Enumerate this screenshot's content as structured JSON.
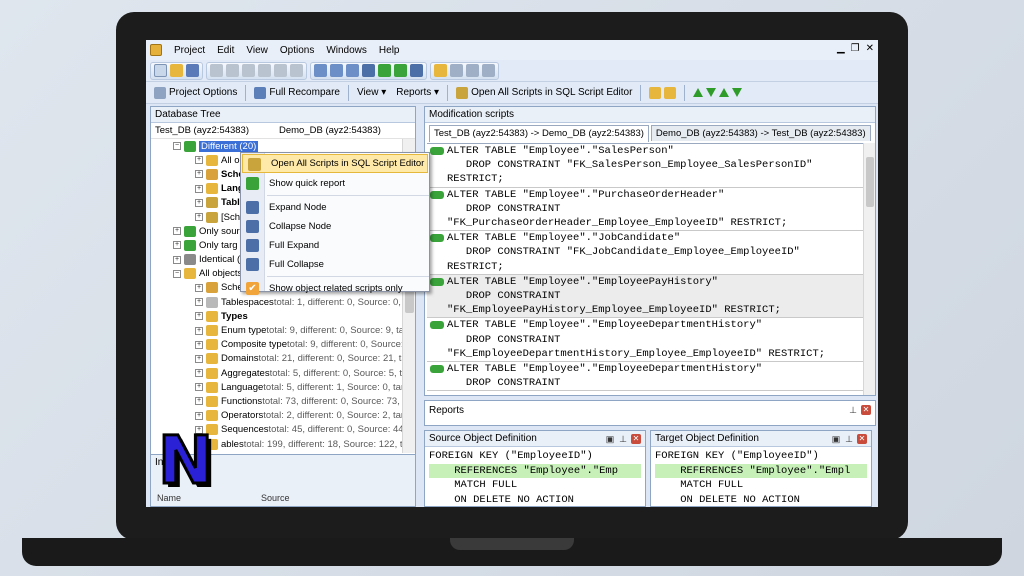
{
  "menu": [
    "Project",
    "Edit",
    "View",
    "Options",
    "Windows",
    "Help"
  ],
  "toolbar2": {
    "project_options": "Project Options",
    "full_recompare": "Full Recompare",
    "view": "View ▾",
    "reports": "Reports ▾",
    "open_all_scripts": "Open All Scripts in SQL Script Editor"
  },
  "database_tree": {
    "title": "Database Tree",
    "left_db": "Test_DB (ayz2:54383)",
    "right_db": "Demo_DB (ayz2:54383)",
    "rows": [
      {
        "label": "Different (20)",
        "detail": ""
      },
      {
        "label": "All obj",
        "detail": ""
      },
      {
        "label": "Sche",
        "detail": ""
      },
      {
        "label": "Lang",
        "detail": ""
      },
      {
        "label": "Tabl",
        "detail": ""
      },
      {
        "label": "[Sche",
        "detail": ""
      },
      {
        "label": "Only sour",
        "detail": ""
      },
      {
        "label": "Only targ",
        "detail": ""
      },
      {
        "label": "Identical (",
        "detail": ""
      },
      {
        "label": "All objects",
        "detail": ""
      },
      {
        "label": "Sche",
        "detail": ""
      },
      {
        "label": "Tablespaces",
        "detail": " total: 1, different: 0, Source: 0, ta"
      },
      {
        "label": "Types",
        "detail": ""
      },
      {
        "label": "Enum type",
        "detail": " total: 9, different: 0, Source: 9, targ"
      },
      {
        "label": "Composite type",
        "detail": " total: 9, different: 0, Source: 9,"
      },
      {
        "label": "Domains",
        "detail": " total: 21, different: 0, Source: 21, targ"
      },
      {
        "label": "Aggregates",
        "detail": " total: 5, different: 0, Source: 5, targ"
      },
      {
        "label": "Language",
        "detail": " total: 5, different: 1, Source: 0, targ"
      },
      {
        "label": "Functions",
        "detail": " total: 73, different: 0, Source: 73, targ"
      },
      {
        "label": "Operators",
        "detail": " total: 2, different: 0, Source: 2, targ"
      },
      {
        "label": "Sequences",
        "detail": " total: 45, different: 0, Source: 44, t"
      },
      {
        "label": "ables",
        "detail": " total: 199, different: 18, Source: 122, ta"
      }
    ]
  },
  "bottom_left": {
    "title": "In",
    "col1": "Name",
    "col2": "Source"
  },
  "context_menu": [
    "Open All Scripts in SQL Script Editor",
    "Show quick report",
    "Expand Node",
    "Collapse Node",
    "Full Expand",
    "Full Collapse",
    "Show object related scripts only"
  ],
  "modification_scripts": {
    "title": "Modification scripts",
    "tab_active": "Test_DB (ayz2:54383) -> Demo_DB (ayz2:54383)",
    "tab_inactive": "Demo_DB (ayz2:54383) -> Test_DB (ayz2:54383)",
    "statements": [
      "ALTER TABLE \"Employee\".\"SalesPerson\"\n   DROP CONSTRAINT \"FK_SalesPerson_Employee_SalesPersonID\"\nRESTRICT;",
      "ALTER TABLE \"Employee\".\"PurchaseOrderHeader\"\n   DROP CONSTRAINT\n\"FK_PurchaseOrderHeader_Employee_EmployeeID\" RESTRICT;",
      "ALTER TABLE \"Employee\".\"JobCandidate\"\n   DROP CONSTRAINT \"FK_JobCandidate_Employee_EmployeeID\"\nRESTRICT;",
      "ALTER TABLE \"Employee\".\"EmployeePayHistory\"\n   DROP CONSTRAINT\n\"FK_EmployeePayHistory_Employee_EmployeeID\" RESTRICT;",
      "ALTER TABLE \"Employee\".\"EmployeeDepartmentHistory\"\n   DROP CONSTRAINT\n\"FK_EmployeeDepartmentHistory_Employee_EmployeeID\" RESTRICT;",
      "ALTER TABLE \"Employee\".\"EmployeeDepartmentHistory\"\n   DROP CONSTRAINT"
    ]
  },
  "reports": {
    "title": "Reports"
  },
  "source_def": {
    "title": "Source Object Definition",
    "lines": [
      "FOREIGN KEY (\"EmployeeID\")",
      "    REFERENCES \"Employee\".\"Emp",
      "    MATCH FULL",
      "    ON DELETE NO ACTION"
    ]
  },
  "target_def": {
    "title": "Target Object Definition",
    "lines": [
      "FOREIGN KEY (\"EmployeeID\")",
      "    REFERENCES \"Employee\".\"Empl",
      "    MATCH FULL",
      "    ON DELETE NO ACTION"
    ]
  },
  "logo": {
    "letter": "N"
  },
  "colors": {
    "selection": "#3a6fd8",
    "diff_icon": "#3aa33a",
    "highlight": "#c6f0b8"
  }
}
